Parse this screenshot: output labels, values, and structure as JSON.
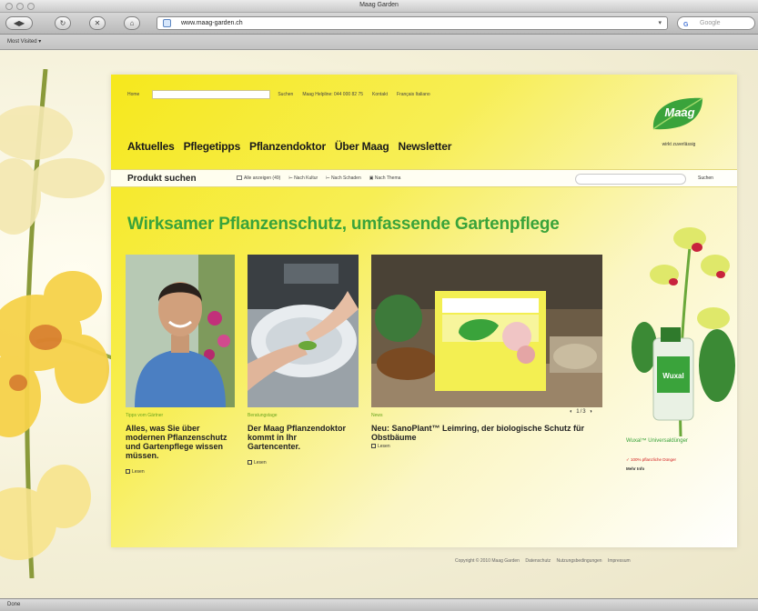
{
  "window": {
    "title": "Maag Garden"
  },
  "toolbar": {
    "url": "www.maag-garden.ch",
    "search_placeholder": "Google",
    "url_dropdown": "▾"
  },
  "bookmarks": {
    "item": "Most Visited ▾"
  },
  "status": {
    "text": "Done"
  },
  "site": {
    "meta": {
      "home": "Home",
      "search_button": "Suchen",
      "helpline": "Maag Helpline: 044 000 82 75",
      "contact": "Kontakt",
      "languages": "Français Italiano"
    },
    "logo": {
      "text": "Maag",
      "tagline": "wirkt zuverlässig"
    },
    "nav": [
      "Aktuelles",
      "Pflegetipps",
      "Pflanzendoktor",
      "Über Maag",
      "Newsletter"
    ],
    "product_search": {
      "title": "Produkt suchen",
      "links": [
        "Alle anzeigen (49)",
        "Nach Kultur",
        "Nach Schaden",
        "Nach Thema"
      ],
      "button": "Suchen"
    },
    "headline": "Wirksamer Pflanzenschutz, umfassende Gartenpflege",
    "teasers": [
      {
        "category": "Tipps vom Gärtner",
        "title": "Alles, was Sie über modernen Pflanzenschutz und Gartenpflege wissen müssen.",
        "link": "Lesen"
      },
      {
        "category": "Beratungstage",
        "title": "Der Maag Pflanzendoktor kommt in Ihr Gartencenter.",
        "link": "Lesen"
      },
      {
        "category": "News",
        "title": "Neu: SanoPlant™ Leimring, der biologische Schutz für Obstbäume",
        "link": "Lesen"
      }
    ],
    "pager": "◐ 1/3 ◑",
    "product_promo": {
      "name": "Wuxal™ Universaldünger",
      "claim": "✓ 100% pflanzliche Dünger",
      "more": "Mehr Info"
    },
    "footer": [
      "Copyright © 2010 Maag Garden",
      "Datenschutz",
      "Nutzungsbedingungen",
      "Impressum"
    ]
  }
}
